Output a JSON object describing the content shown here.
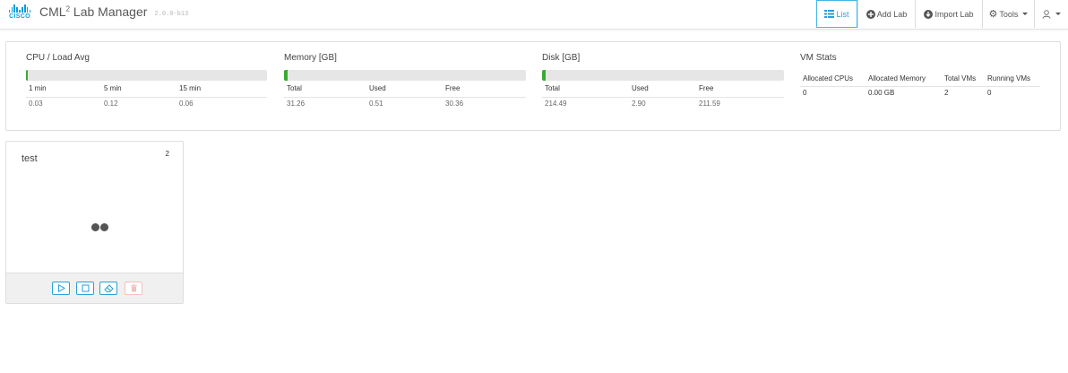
{
  "brand": {
    "logo_text": "CISCO",
    "app_name": "CML",
    "app_sup": "2",
    "app_suffix": " Lab Manager",
    "version": "2.0.0-b13"
  },
  "nav": {
    "list_label": "List",
    "add_lab_label": "Add Lab",
    "import_lab_label": "Import Lab",
    "tools_label": "Tools"
  },
  "stats": {
    "cpu": {
      "title": "CPU / Load Avg",
      "fill_percent": 0.5,
      "headers": [
        "1 min",
        "5 min",
        "15 min"
      ],
      "values": [
        "0.03",
        "0.12",
        "0.06"
      ]
    },
    "memory": {
      "title": "Memory [GB]",
      "fill_percent": 1.6,
      "headers": [
        "Total",
        "Used",
        "Free"
      ],
      "values": [
        "31.26",
        "0.51",
        "30.36"
      ]
    },
    "disk": {
      "title": "Disk [GB]",
      "fill_percent": 1.4,
      "headers": [
        "Total",
        "Used",
        "Free"
      ],
      "values": [
        "214.49",
        "2.90",
        "211.59"
      ]
    },
    "vm": {
      "title": "VM Stats",
      "headers": [
        "Allocated CPUs",
        "Allocated Memory",
        "Total VMs",
        "Running VMs"
      ],
      "values": [
        "0",
        "0.00 GB",
        "2",
        "0"
      ]
    }
  },
  "labs": [
    {
      "name": "test",
      "node_count": "2"
    }
  ],
  "colors": {
    "accent": "#2a9fd6",
    "cisco_blue": "#049fd9",
    "bar_fill": "#3aaa35"
  }
}
